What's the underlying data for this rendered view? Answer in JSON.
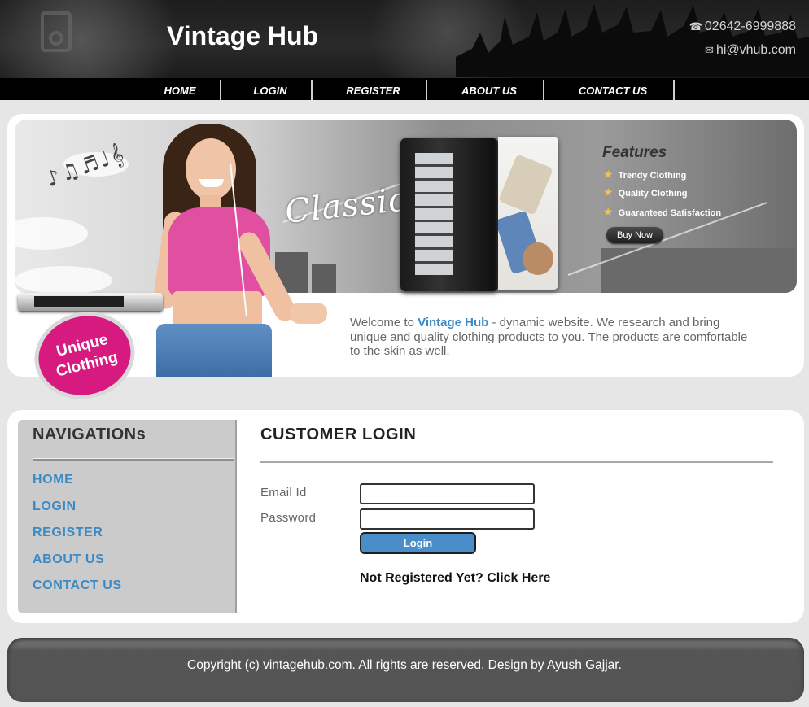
{
  "header": {
    "site_title": "Vintage Hub",
    "phone": "02642-6999888",
    "email": "hi@vhub.com"
  },
  "top_nav": [
    "HOME",
    "LOGIN",
    "REGISTER",
    "ABOUT US",
    "CONTACT US"
  ],
  "banner": {
    "classic_text": "Classic",
    "features_title": "Features",
    "features": [
      "Trendy Clothing",
      "Quality Clothing",
      "Guaranteed Satisfaction"
    ],
    "buy_now": "Buy Now",
    "badge_line1": "Unique",
    "badge_line2": "Clothing",
    "welcome_prefix": "Welcome to ",
    "welcome_brand": "Vintage Hub",
    "welcome_suffix": " - dynamic website. We research and bring unique and quality clothing products to you. The products are comfortable to the skin as well."
  },
  "sidebar": {
    "title": "NAVIGATIONs",
    "links": [
      "HOME",
      "LOGIN",
      "REGISTER",
      "ABOUT US",
      "CONTACT US"
    ]
  },
  "login": {
    "title": "CUSTOMER LOGIN",
    "email_label": "Email Id",
    "email_value": "",
    "password_label": "Password",
    "password_value": "",
    "button": "Login",
    "register_link": "Not Registered Yet? Click Here"
  },
  "footer": {
    "text_prefix": "Copyright (c) vintagehub.com. All rights are reserved. Design by ",
    "author": "Ayush Gajjar",
    "text_suffix": "."
  },
  "colors": {
    "accent_blue": "#3b8ac4",
    "badge_pink": "#d61a80",
    "header_black": "#1d1d1d"
  }
}
